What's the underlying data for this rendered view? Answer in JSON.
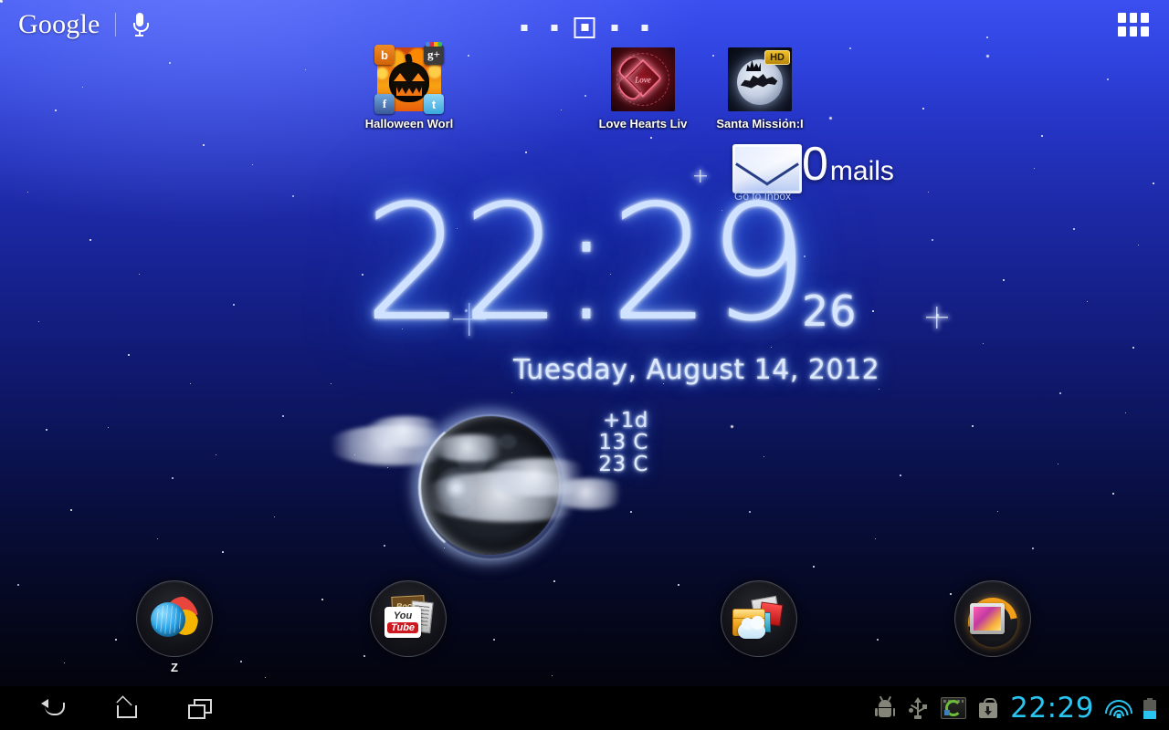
{
  "wallpaper": {
    "name": "starfield-night-sky",
    "gradient_top": "#3b4ff0",
    "gradient_mid": "#15208a",
    "gradient_bottom": "#010207"
  },
  "topbar": {
    "google_label": "Google",
    "mic_icon": "microphone-icon",
    "app_drawer_icon": "app-grid-icon",
    "page_indicator": {
      "total": 5,
      "current": 3
    }
  },
  "shortcuts": [
    {
      "label": "Halloween Worl",
      "icon": "halloween-pumpkin-icon",
      "badges": [
        "rss-icon",
        "google-plus-icon",
        "facebook-icon",
        "twitter-icon"
      ],
      "badge_rss": "b",
      "badge_gplus": "g+",
      "badge_fb": "f",
      "badge_tw": "t"
    },
    {
      "label": "Love Hearts Liv",
      "icon": "love-hearts-icon",
      "art_word": "Love"
    },
    {
      "label": "Santa Mission:I",
      "icon": "santa-mission-icon",
      "hd_badge": "HD"
    }
  ],
  "mail_widget": {
    "icon": "envelope-icon",
    "count": "0",
    "unit": "mails",
    "inbox_link": "Go to Inbox"
  },
  "clock_widget": {
    "time": "22:29",
    "seconds": "26",
    "date": "Tuesday, August 14, 2012",
    "glow_color": "#4f86ff"
  },
  "moon_widget": {
    "icon": "moon-with-clouds-icon",
    "forecast_day": "+1d",
    "temp_low": "13 C",
    "temp_high": "23 C"
  },
  "dock": [
    {
      "label": "Z",
      "icon": "browser-globe-icon"
    },
    {
      "label": "",
      "icon": "youtube-media-folder-icon",
      "yt_top": "You",
      "yt_bottom": "Tube",
      "back_label": "Book"
    },
    {
      "label": "",
      "icon": "files-cloud-folder-icon"
    },
    {
      "label": "",
      "icon": "gallery-photo-icon"
    }
  ],
  "navbar": {
    "back_icon": "back-arrow-icon",
    "home_icon": "home-icon",
    "recents_icon": "recent-apps-icon",
    "status_icons": [
      "android-debug-icon",
      "usb-icon",
      "app-sync-icon",
      "download-bag-icon"
    ],
    "clock": "22:29",
    "wifi_icon": "wifi-icon",
    "battery_icon": "battery-icon",
    "accent_color": "#29c5f0"
  }
}
